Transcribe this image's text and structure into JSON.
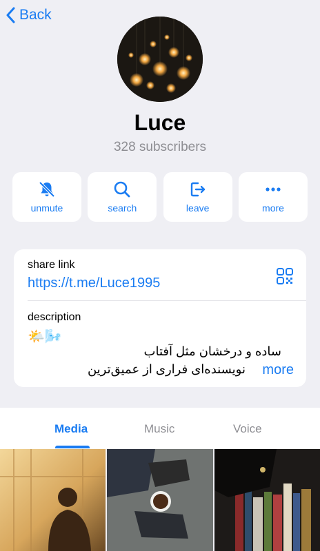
{
  "nav": {
    "back_label": "Back"
  },
  "channel": {
    "name": "Luce",
    "subscribers": "328 subscribers"
  },
  "actions": [
    {
      "label": "unmute",
      "icon": "bell-slash-icon"
    },
    {
      "label": "search",
      "icon": "search-icon"
    },
    {
      "label": "leave",
      "icon": "leave-icon"
    },
    {
      "label": "more",
      "icon": "ellipsis-icon"
    }
  ],
  "info": {
    "share_label": "share link",
    "share_url": "https://t.me/Luce1995",
    "description_label": "description",
    "description_emoji": "🌤️🌬️",
    "description_line1": "ساده و درخشان مثل آفتاب",
    "description_line2": "نویسنده‌ای فراری از عمیق‌ترین نقطه جهان",
    "more_label": "more"
  },
  "tabs": [
    {
      "label": "Media",
      "active": true
    },
    {
      "label": "Music",
      "active": false
    },
    {
      "label": "Voice",
      "active": false
    }
  ],
  "colors": {
    "accent": "#1a7cf2",
    "background": "#efeff4",
    "secondary_text": "#8e8e93"
  }
}
